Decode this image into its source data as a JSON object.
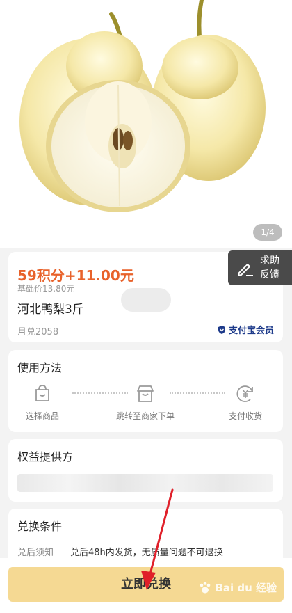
{
  "gallery": {
    "indicator": "1/4"
  },
  "product": {
    "price": "59积分+11.00元",
    "base_price": "基础价13.80元",
    "name": "河北鸭梨3斤",
    "monthly_sales": "月兑2058",
    "member_badge": "支付宝会员"
  },
  "feedback": {
    "line1": "求助",
    "line2": "反馈"
  },
  "usage": {
    "title": "使用方法",
    "steps": [
      {
        "label": "选择商品",
        "icon": "shopping-bag-icon"
      },
      {
        "label": "跳转至商家下单",
        "icon": "store-icon"
      },
      {
        "label": "支付收货",
        "icon": "yen-refresh-icon"
      }
    ]
  },
  "provider": {
    "title": "权益提供方"
  },
  "conditions": {
    "title": "兑换条件",
    "rows": [
      {
        "key": "兑后须知",
        "value": "兑后48h内发货，无质量问题不可退换"
      }
    ]
  },
  "action": {
    "redeem_label": "立即兑换"
  },
  "watermark": {
    "text": "Bai du 经验"
  },
  "colors": {
    "price": "#e8622b",
    "button": "#f5d993",
    "badge": "#1d3a8a",
    "arrow": "#e0202a"
  }
}
